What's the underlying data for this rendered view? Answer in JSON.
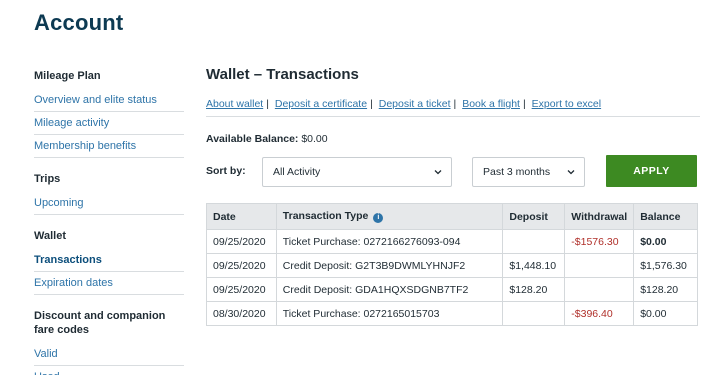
{
  "page_title": "Account",
  "sidebar": {
    "groups": [
      {
        "heading": "Mileage Plan",
        "items": [
          {
            "label": "Overview and elite status"
          },
          {
            "label": "Mileage activity"
          },
          {
            "label": "Membership benefits"
          }
        ]
      },
      {
        "heading": "Trips",
        "items": [
          {
            "label": "Upcoming"
          }
        ]
      },
      {
        "heading": "Wallet",
        "items": [
          {
            "label": "Transactions",
            "active": true
          },
          {
            "label": "Expiration dates"
          }
        ]
      },
      {
        "heading": "Discount and companion fare codes",
        "items": [
          {
            "label": "Valid"
          },
          {
            "label": "Used"
          }
        ]
      }
    ]
  },
  "main": {
    "title": "Wallet – Transactions",
    "links": [
      "About wallet",
      "Deposit a certificate",
      "Deposit a ticket",
      "Book a flight",
      "Export to excel"
    ],
    "balance_label": "Available Balance:",
    "balance_value": "$0.00",
    "sort_label": "Sort by:",
    "activity_select": "All Activity",
    "range_select": "Past 3 months",
    "apply_label": "APPLY"
  },
  "table": {
    "headers": [
      "Date",
      "Transaction Type",
      "Deposit",
      "Withdrawal",
      "Balance"
    ],
    "rows": [
      [
        "09/25/2020",
        "Ticket Purchase: 0272166276093-094",
        "",
        "-$1576.30",
        "$0.00"
      ],
      [
        "09/25/2020",
        "Credit Deposit: G2T3B9DWMLYHNJF2",
        "$1,448.10",
        "",
        "$1,576.30"
      ],
      [
        "09/25/2020",
        "Credit Deposit: GDA1HQXSDGNB7TF2",
        "$128.20",
        "",
        "$128.20"
      ],
      [
        "08/30/2020",
        "Ticket Purchase: 0272165015703",
        "",
        "-$396.40",
        "$0.00"
      ]
    ]
  },
  "colors": {
    "accent": "#3d8a22",
    "link": "#2e74a8",
    "title": "#0d3a52",
    "negative": "#b0302a"
  }
}
